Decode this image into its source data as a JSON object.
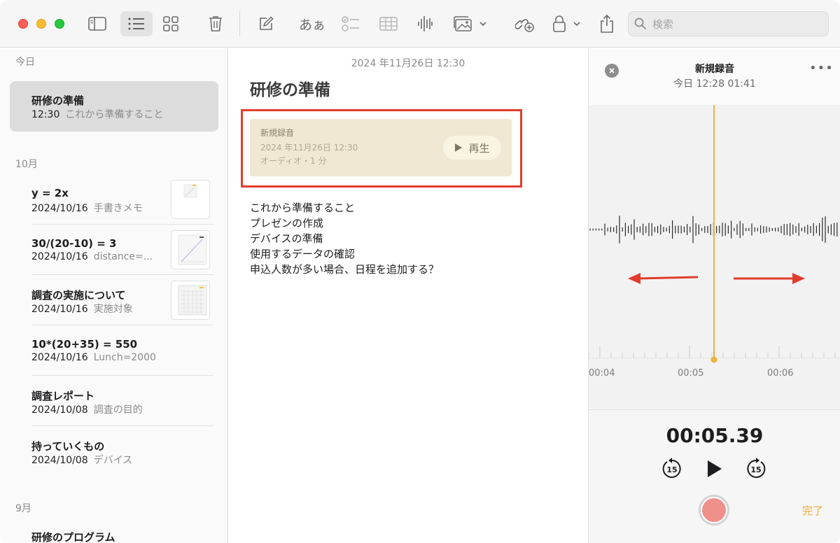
{
  "toolbar": {
    "search_placeholder": "検索",
    "format_label": "あぁ"
  },
  "sidebar": {
    "sections": [
      {
        "label": "今日"
      },
      {
        "label": "10月"
      },
      {
        "label": "9月"
      }
    ],
    "notes": [
      {
        "title": "研修の準備",
        "date": "12:30",
        "preview": "これから準備すること",
        "selected": true
      },
      {
        "title": "y = 2x",
        "date": "2024/10/16",
        "preview": "手書きメモ",
        "thumb": true
      },
      {
        "title": "30/(20-10) = 3",
        "date": "2024/10/16",
        "preview": "distance=...",
        "thumb": true
      },
      {
        "title": "調査の実施について",
        "date": "2024/10/16",
        "preview": "実施対象",
        "thumb": true
      },
      {
        "title": "10*(20+35) = 550",
        "date": "2024/10/16",
        "preview": "Lunch=2000"
      },
      {
        "title": "調査レポート",
        "date": "2024/10/08",
        "preview": "調査の目的"
      },
      {
        "title": "持っていくもの",
        "date": "2024/10/08",
        "preview": "デバイス"
      },
      {
        "title": "研修のプログラム",
        "date": "",
        "preview": ""
      }
    ]
  },
  "editor": {
    "date": "2024 年11月26日 12:30",
    "title": "研修の準備",
    "recording": {
      "name": "新規録音",
      "date": "2024 年11月26日 12:30",
      "info": "オーディオ・1 分",
      "play_label": "再生"
    },
    "body_lines": [
      "これから準備すること",
      "プレゼンの作成",
      "デバイスの準備",
      "使用するデータの確認",
      "申込人数が多い場合、日程を追加する？"
    ]
  },
  "panel": {
    "title": "新規録音",
    "subtitle": "今日 12:28   01:41",
    "ticks": [
      "00:04",
      "00:05",
      "00:06"
    ],
    "current_time": "00:05.39",
    "skip_back": "15",
    "skip_forward": "15",
    "done_label": "完了",
    "accent": "#f0a92d",
    "arrow_color": "#e23c2c"
  }
}
